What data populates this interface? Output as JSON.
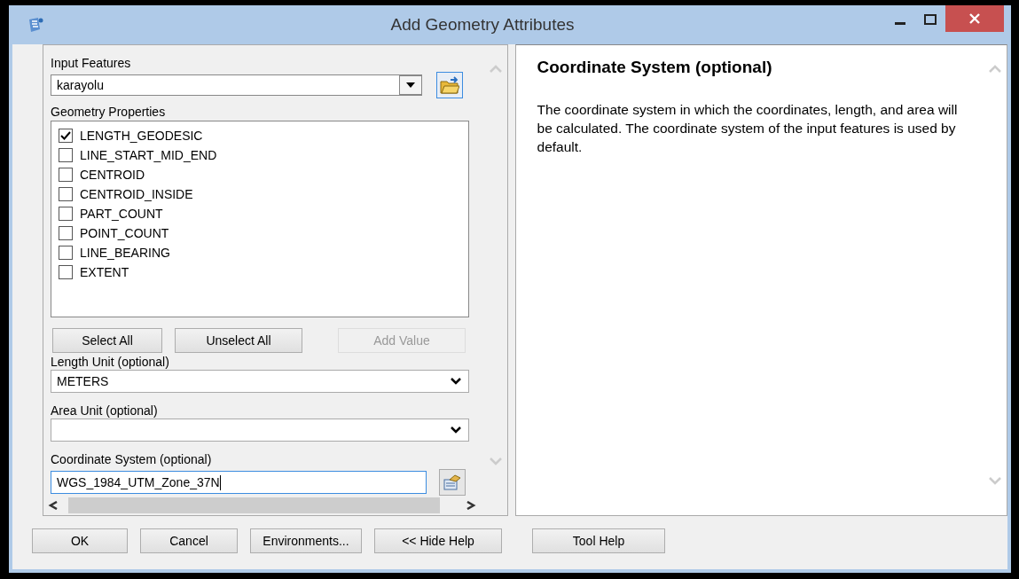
{
  "window": {
    "title": "Add Geometry Attributes"
  },
  "input_features": {
    "label": "Input Features",
    "value": "karayolu"
  },
  "geometry_properties": {
    "label": "Geometry Properties",
    "items": [
      {
        "label": "LENGTH_GEODESIC",
        "checked": true
      },
      {
        "label": "LINE_START_MID_END",
        "checked": false
      },
      {
        "label": "CENTROID",
        "checked": false
      },
      {
        "label": "CENTROID_INSIDE",
        "checked": false
      },
      {
        "label": "PART_COUNT",
        "checked": false
      },
      {
        "label": "POINT_COUNT",
        "checked": false
      },
      {
        "label": "LINE_BEARING",
        "checked": false
      },
      {
        "label": "EXTENT",
        "checked": false
      }
    ]
  },
  "list_buttons": [
    {
      "label": "Select All",
      "disabled": false
    },
    {
      "label": "Unselect All",
      "disabled": false
    },
    {
      "label": "Add Value",
      "disabled": true
    }
  ],
  "length_unit": {
    "label": "Length Unit (optional)",
    "value": "METERS"
  },
  "area_unit": {
    "label": "Area Unit (optional)"
  },
  "coordinate_system": {
    "label": "Coordinate System (optional)",
    "value": "WGS_1984_UTM_Zone_37N"
  },
  "help": {
    "title": "Coordinate System (optional)",
    "body": "The coordinate system in which the coordinates, length, and area will be calculated. The coordinate system of the input features is used by default."
  },
  "footer_buttons": [
    {
      "label": "OK"
    },
    {
      "label": "Cancel"
    },
    {
      "label": "Environments..."
    },
    {
      "label": "<< Hide Help"
    },
    {
      "label": "Tool Help"
    }
  ]
}
